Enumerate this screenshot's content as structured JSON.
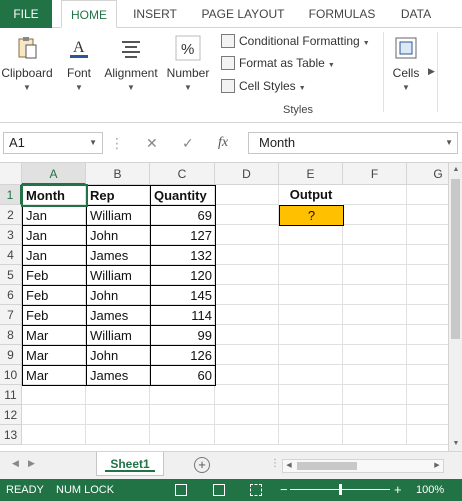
{
  "ribbon": {
    "tabs": [
      "FILE",
      "HOME",
      "INSERT",
      "PAGE LAYOUT",
      "FORMULAS",
      "DATA"
    ],
    "groups": {
      "clipboard": "Clipboard",
      "font": "Font",
      "alignment": "Alignment",
      "number": "Number",
      "cells": "Cells"
    },
    "styles": {
      "conditional": "Conditional Formatting",
      "table": "Format as Table",
      "cell_styles": "Cell Styles",
      "group_label": "Styles"
    }
  },
  "formula_bar": {
    "name_box": "A1",
    "content": "Month",
    "fx": "fx",
    "cancel": "✕",
    "confirm": "✓"
  },
  "columns": [
    "A",
    "B",
    "C",
    "D",
    "E",
    "F",
    "G"
  ],
  "rows": [
    "1",
    "2",
    "3",
    "4",
    "5",
    "6",
    "7",
    "8",
    "9",
    "10",
    "11",
    "12",
    "13"
  ],
  "table": {
    "headers": [
      "Month",
      "Rep",
      "Quantity"
    ],
    "rows": [
      [
        "Jan",
        "William",
        "69"
      ],
      [
        "Jan",
        "John",
        "127"
      ],
      [
        "Jan",
        "James",
        "132"
      ],
      [
        "Feb",
        "William",
        "120"
      ],
      [
        "Feb",
        "John",
        "145"
      ],
      [
        "Feb",
        "James",
        "114"
      ],
      [
        "Mar",
        "William",
        "99"
      ],
      [
        "Mar",
        "John",
        "126"
      ],
      [
        "Mar",
        "James",
        "60"
      ]
    ]
  },
  "output": {
    "label": "Output",
    "value": "?"
  },
  "sheet": {
    "tab": "Sheet1",
    "add": "+"
  },
  "status": {
    "ready": "READY",
    "numlock": "NUM LOCK",
    "zoom": "100%",
    "minus": "−",
    "plus": "+"
  },
  "colors": {
    "accent": "#217346",
    "output_fill": "#ffc000"
  }
}
